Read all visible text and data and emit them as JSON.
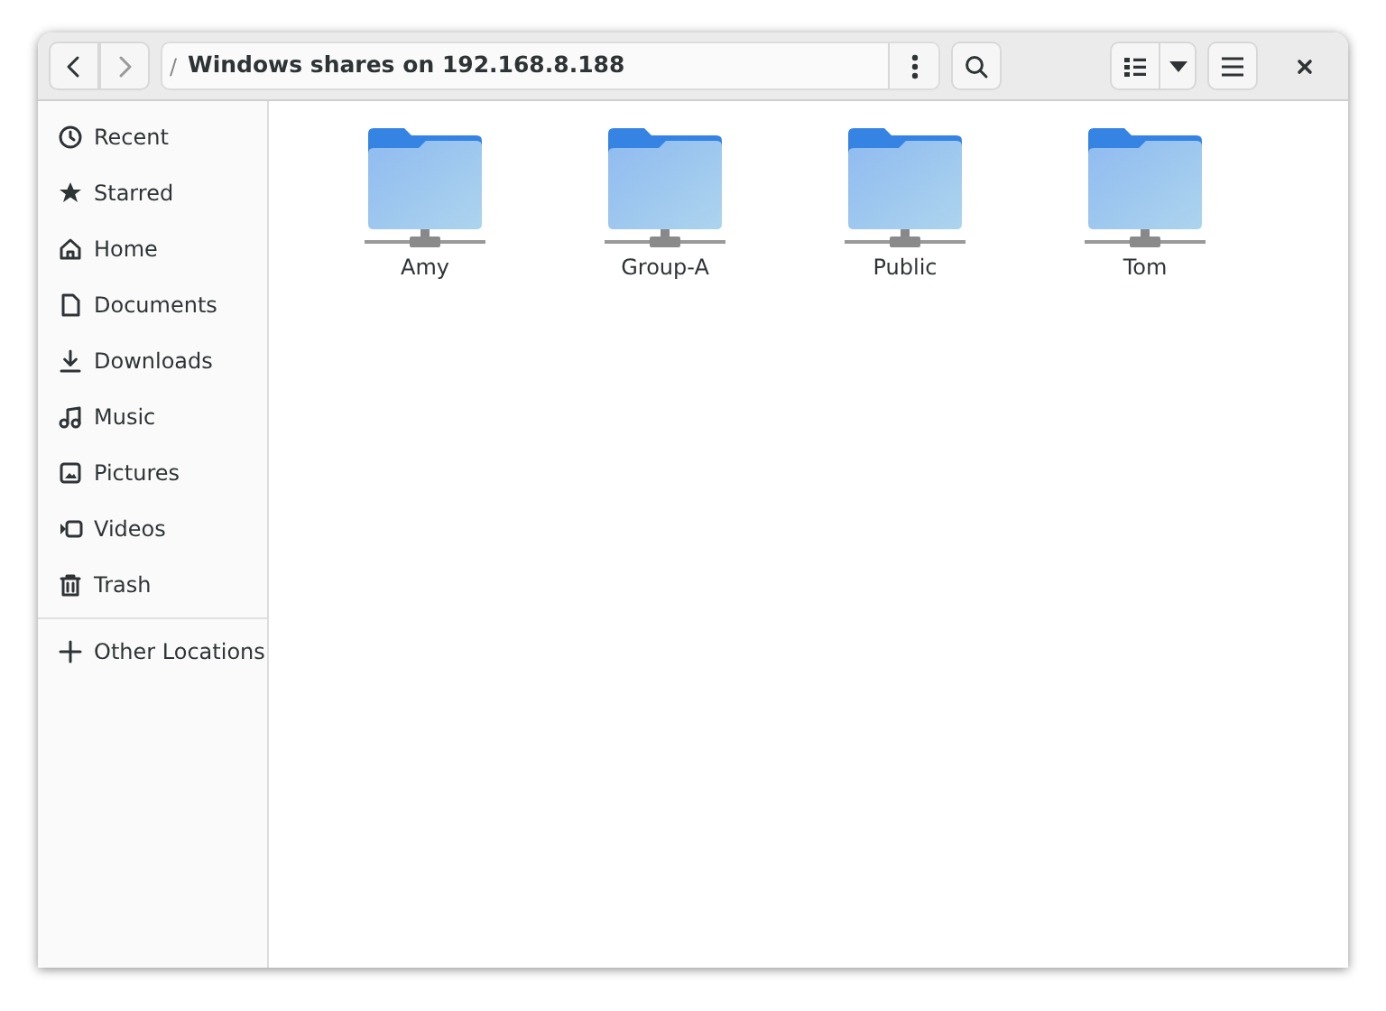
{
  "headerbar": {
    "nav_buttons": [
      {
        "kind": "back",
        "disabled": false
      },
      {
        "kind": "forward",
        "disabled": true
      }
    ],
    "path_separator": "/",
    "path": "Windows shares on 192.168.8.188"
  },
  "sidebar": {
    "items": [
      {
        "kind": "recent",
        "label": "Recent"
      },
      {
        "kind": "starred",
        "label": "Starred"
      },
      {
        "kind": "home",
        "label": "Home"
      },
      {
        "kind": "documents",
        "label": "Documents"
      },
      {
        "kind": "downloads",
        "label": "Downloads"
      },
      {
        "kind": "music",
        "label": "Music"
      },
      {
        "kind": "pictures",
        "label": "Pictures"
      },
      {
        "kind": "videos",
        "label": "Videos"
      },
      {
        "kind": "trash",
        "label": "Trash"
      },
      {
        "kind": "divider"
      },
      {
        "kind": "other",
        "label": "Other Locations"
      }
    ]
  },
  "files": [
    {
      "name": "Amy"
    },
    {
      "name": "Group-A"
    },
    {
      "name": "Public"
    },
    {
      "name": "Tom"
    }
  ]
}
